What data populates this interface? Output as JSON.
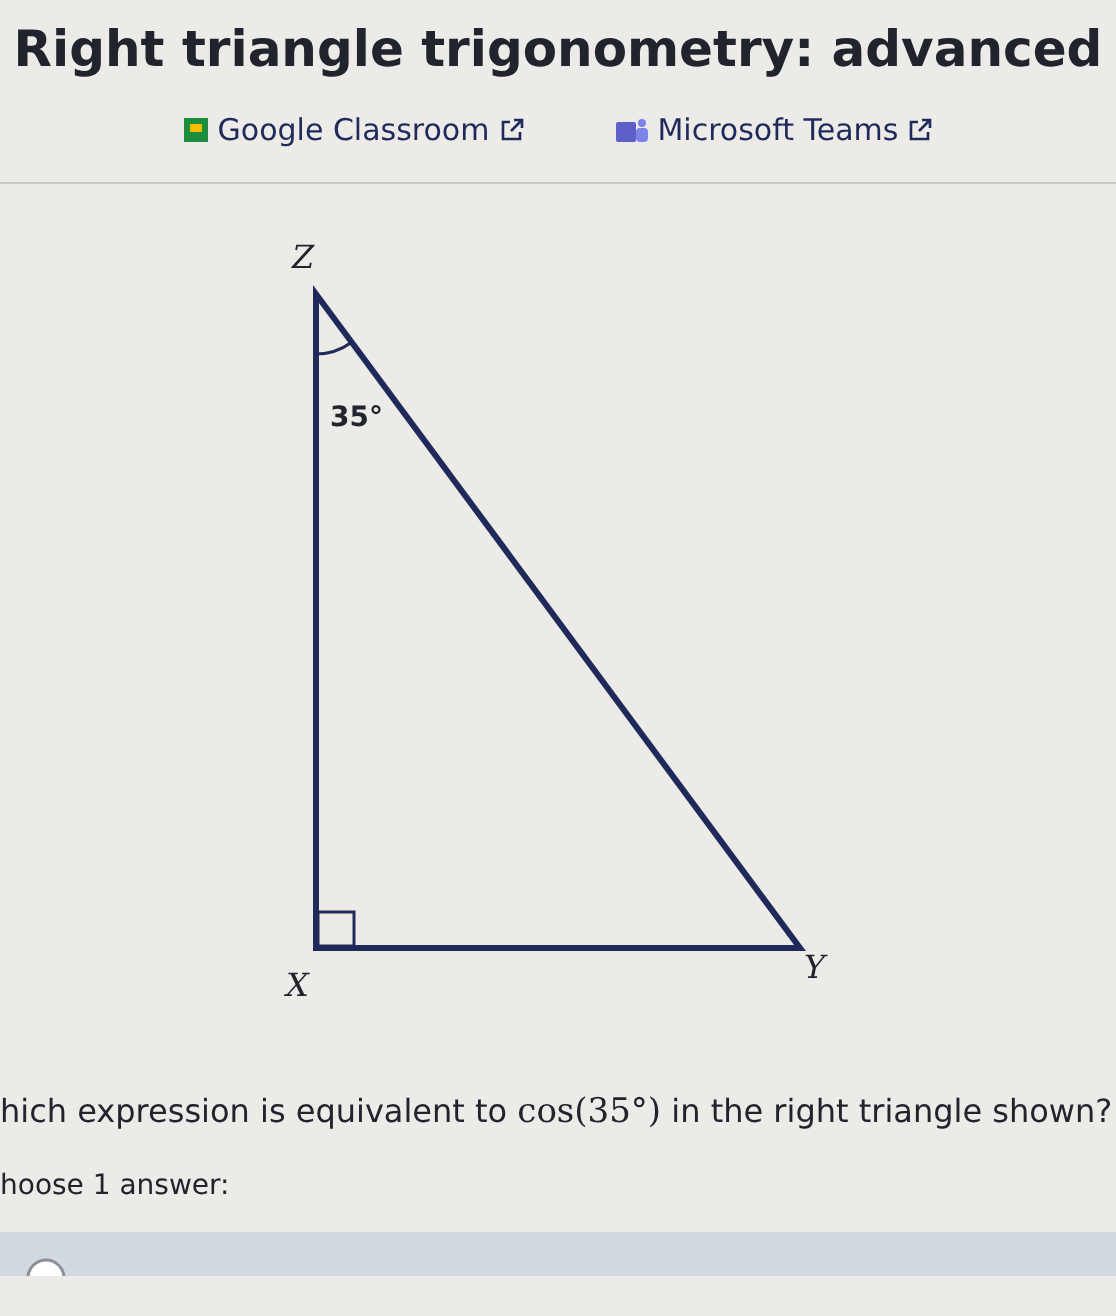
{
  "title": "Right triangle trigonometry: advanced",
  "share_links": [
    {
      "kind": "classroom",
      "label": "Google Classroom"
    },
    {
      "kind": "teams",
      "label": "Microsoft Teams"
    }
  ],
  "figure": {
    "vertices": [
      {
        "label": "Z"
      },
      {
        "label": "X"
      },
      {
        "label": "Y"
      }
    ],
    "angle_label": "35°"
  },
  "question": {
    "before": "hich expression is equivalent to ",
    "math": "cos(35°)",
    "after": " in the right triangle shown?"
  },
  "instruction": "hoose 1 answer:"
}
